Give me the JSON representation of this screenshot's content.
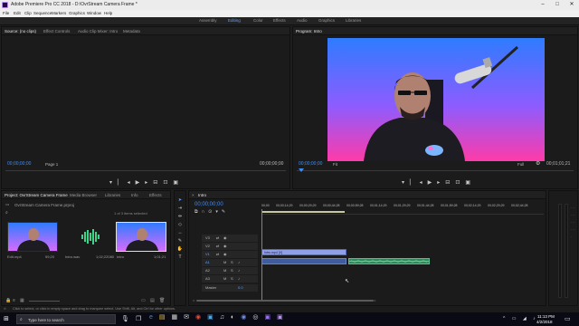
{
  "window": {
    "title": "Adobe Premiere Pro CC 2018 - D:\\OvrStream Camera Frame *"
  },
  "menu": [
    "File",
    "Edit",
    "Clip",
    "Sequence",
    "Markers",
    "Graphics",
    "Window",
    "Help"
  ],
  "workspaces": [
    {
      "label": "Assembly",
      "active": false
    },
    {
      "label": "Editing",
      "active": true
    },
    {
      "label": "Color",
      "active": false
    },
    {
      "label": "Effects",
      "active": false
    },
    {
      "label": "Audio",
      "active": false
    },
    {
      "label": "Graphics",
      "active": false
    },
    {
      "label": "Libraries",
      "active": false
    }
  ],
  "source_panel": {
    "tabs": [
      "Source: (no clips)",
      "Effect Controls",
      "Audio Clip Mixer: Intro",
      "Metadata"
    ],
    "timecode_left": "00;00;00;00",
    "page": "Page 1",
    "timecode_right": "00;00;00;00"
  },
  "program_panel": {
    "tab": "Program: Intro",
    "timecode_left": "00;00;00;00",
    "fit": "Fit",
    "full": "Full",
    "timecode_right": "00;01;01;21"
  },
  "project_panel": {
    "tabs": [
      "Project: OvrStream Camera Frame",
      "Media Browser",
      "Libraries",
      "Info",
      "Effects"
    ],
    "file": "OvrStream Camera Frame.prproj",
    "selection": "1 of 3 items selected",
    "items": [
      {
        "name": "Edit.mp4",
        "duration": "59;20"
      },
      {
        "name": "Intro.wav",
        "duration": "1;02;22080"
      },
      {
        "name": "Intro",
        "duration": "1;01;21"
      }
    ]
  },
  "timeline": {
    "tab": "Intro",
    "timecode": "00;00;00;00",
    "ruler": [
      "00;00",
      "00;00;14;29",
      "00;00;29;29",
      "00;00;44;28",
      "00;00;59;28",
      "00;01;14;29",
      "00;01;29;29",
      "00;01;44;28",
      "00;01;59;28",
      "00;02;14;29",
      "00;02;29;29",
      "00;02;44;28"
    ],
    "tracks": [
      "V3",
      "V2",
      "V1",
      "A1",
      "A2",
      "A3",
      "Master"
    ],
    "master_value": "0.0",
    "video_clip": "Intro.mp4 [V]"
  },
  "status_bar": "Click to select, or click in empty space and drag to marquee select. Use Shift, Alt, and Ctrl for other options.",
  "taskbar": {
    "search": "Type here to search",
    "time": "11:13 PM",
    "date": "4/2/2018"
  },
  "colors": {
    "accent": "#3f8df5",
    "gradient_top": "#2e7cff",
    "gradient_bottom": "#ff3ba8"
  }
}
